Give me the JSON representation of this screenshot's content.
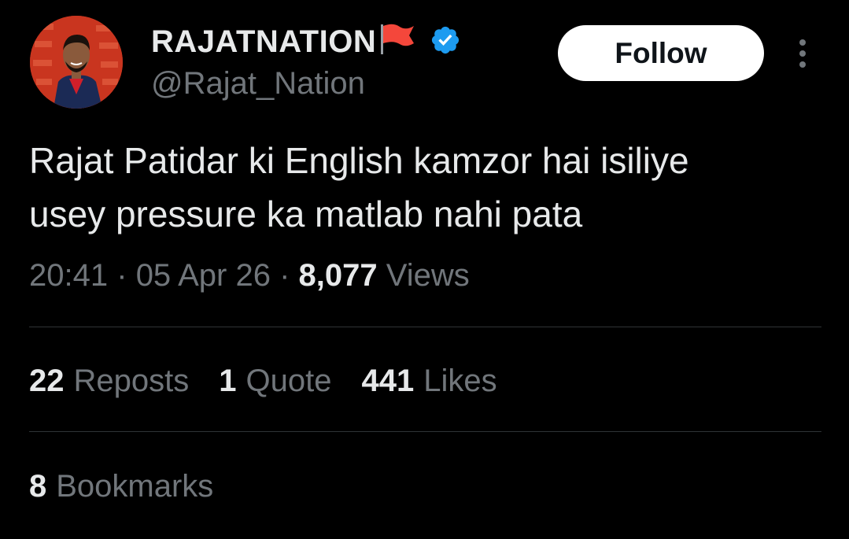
{
  "author": {
    "display_name": "RAJATNATION",
    "handle": "@Rajat_Nation",
    "verified_color": "#1d9bf0",
    "flag_color": "#f4473b"
  },
  "follow_label": "Follow",
  "tweet": {
    "text_lines": [
      "Rajat Patidar ki English kamzor hai isiliye",
      "usey pressure ka matlab nahi pata"
    ],
    "time": "20:41",
    "separator": "·",
    "date": "05 Apr 26",
    "views_count": "8,077",
    "views_label": "Views"
  },
  "stats": {
    "reposts": {
      "count": "22",
      "label": "Reposts"
    },
    "quotes": {
      "count": "1",
      "label": "Quote"
    },
    "likes": {
      "count": "441",
      "label": "Likes"
    },
    "bookmarks": {
      "count": "8",
      "label": "Bookmarks"
    }
  }
}
